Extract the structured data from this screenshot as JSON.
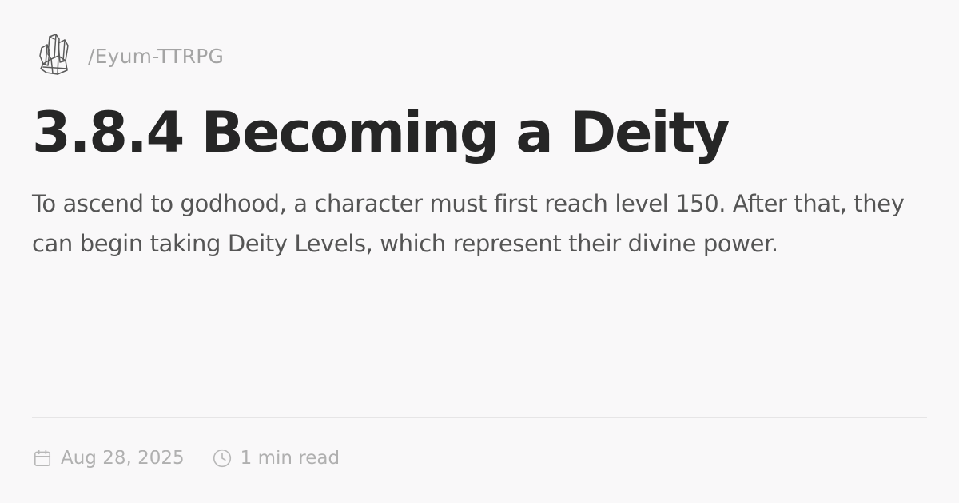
{
  "site": {
    "logo_icon": "crystal-cluster-icon",
    "path": "/Eyum-TTRPG"
  },
  "page": {
    "title": "3.8.4 Becoming a Deity",
    "description": "To ascend to godhood, a character must first reach level 150. After that, they can begin taking Deity Levels, which represent their divine power."
  },
  "meta": {
    "date_icon": "calendar-icon",
    "date": "Aug 28, 2025",
    "read_time_icon": "clock-icon",
    "read_time": "1 min read"
  },
  "colors": {
    "background": "#f9f8f9",
    "title": "#262626",
    "body_text": "#555555",
    "muted_text": "#a4a4a4"
  }
}
